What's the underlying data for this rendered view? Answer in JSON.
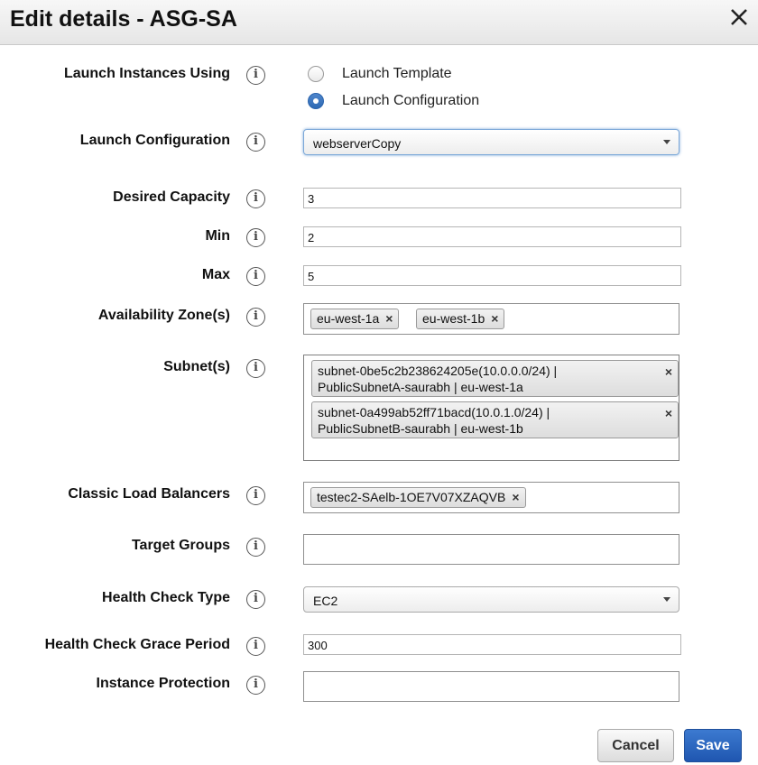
{
  "dialog": {
    "title": "Edit details - ASG-SA",
    "close_icon": "close-icon"
  },
  "fields": {
    "launch_using": {
      "label": "Launch Instances Using",
      "options": [
        {
          "label": "Launch Template",
          "selected": false
        },
        {
          "label": "Launch Configuration",
          "selected": true
        }
      ]
    },
    "launch_configuration": {
      "label": "Launch Configuration",
      "value": "webserverCopy"
    },
    "desired_capacity": {
      "label": "Desired Capacity",
      "value": "3"
    },
    "min": {
      "label": "Min",
      "value": "2"
    },
    "max": {
      "label": "Max",
      "value": "5"
    },
    "availability_zones": {
      "label": "Availability Zone(s)",
      "tags": [
        "eu-west-1a",
        "eu-west-1b"
      ]
    },
    "subnets": {
      "label": "Subnet(s)",
      "items": [
        {
          "line1": "subnet-0be5c2b238624205e(10.0.0.0/24) |",
          "line2": "PublicSubnetA-saurabh | eu-west-1a"
        },
        {
          "line1": "subnet-0a499ab52ff71bacd(10.0.1.0/24) |",
          "line2": "PublicSubnetB-saurabh | eu-west-1b"
        }
      ]
    },
    "classic_load_balancers": {
      "label": "Classic Load Balancers",
      "tags": [
        "testec2-SAelb-1OE7V07XZAQVB"
      ]
    },
    "target_groups": {
      "label": "Target Groups",
      "value": ""
    },
    "health_check_type": {
      "label": "Health Check Type",
      "value": "EC2"
    },
    "health_check_grace_period": {
      "label": "Health Check Grace Period",
      "value": "300"
    },
    "instance_protection": {
      "label": "Instance Protection",
      "value": ""
    }
  },
  "info_icon_glyph": "i",
  "tag_remove_glyph": "×",
  "buttons": {
    "cancel": "Cancel",
    "save": "Save"
  },
  "colors": {
    "accent": "#2d69b3",
    "save_button": "#1f56b0"
  }
}
